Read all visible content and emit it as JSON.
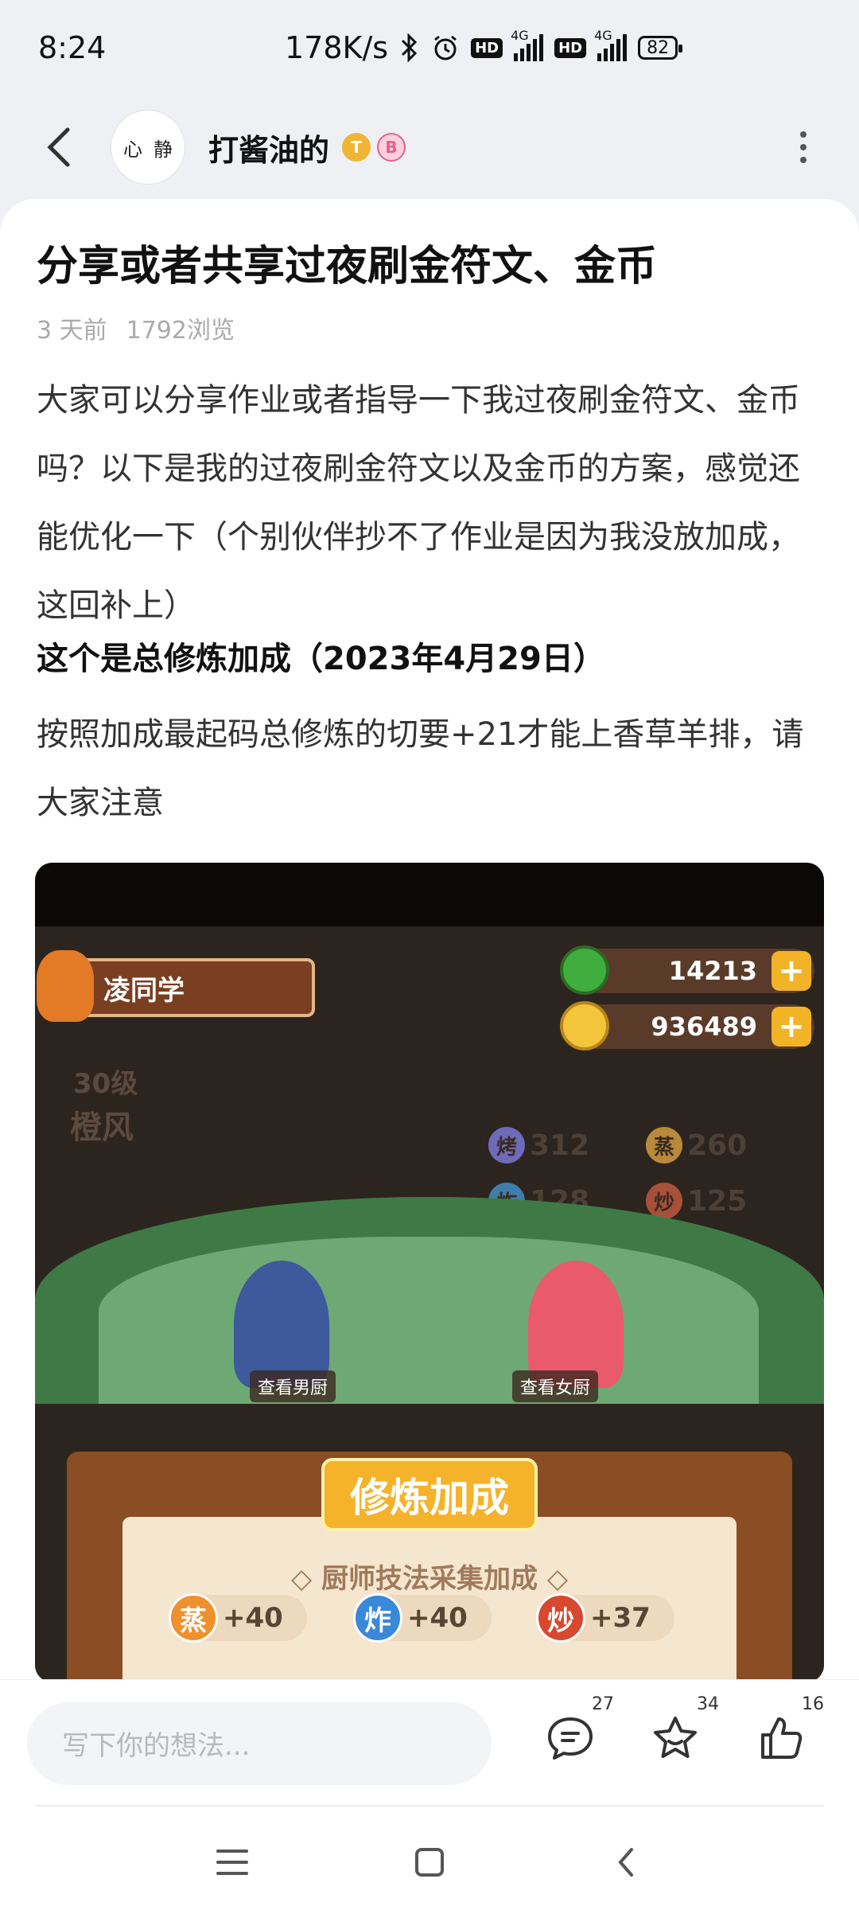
{
  "status_bar": {
    "time": "8:24",
    "net_speed": "178K/s",
    "signal_tag": "4G",
    "hd_label": "HD",
    "battery": "82"
  },
  "header": {
    "avatar_text_1": "心",
    "avatar_text_2": "静",
    "username": "打酱油的",
    "badge_t": "T",
    "badge_b": "B"
  },
  "post": {
    "title": "分享或者共享过夜刷金符文、金币",
    "time_ago": "3 天前",
    "views": "1792浏览",
    "body": "大家可以分享作业或者指导一下我过夜刷金符文、金币吗？以下是我的过夜刷金符文以及金币的方案，感觉还能优化一下（个别伙伴抄不了作业是因为我没放加成，这回补上）",
    "subtitle": "这个是总修炼加成（2023年4月29日）",
    "note": "按照加成最起码总修炼的切要+21才能上香草羊排，请大家注意"
  },
  "game_screenshot": {
    "player_name": "凌同学",
    "jade": "14213",
    "coins": "936489",
    "level": "30级",
    "char_name": "橙风",
    "skills": [
      {
        "icon": "烤",
        "value": "312"
      },
      {
        "icon": "蒸",
        "value": "260"
      },
      {
        "icon": "炸",
        "value": "128"
      },
      {
        "icon": "炒",
        "value": "125"
      }
    ],
    "view_male_chef": "查看男厨",
    "view_female_chef": "查看女厨",
    "bonus_title": "修炼加成",
    "collect_title": "◇ 厨师技法采集加成 ◇",
    "bonuses": [
      {
        "icon": "蒸",
        "value": "+40",
        "color": "#f0902c"
      },
      {
        "icon": "炸",
        "value": "+40",
        "color": "#3a88d8"
      },
      {
        "icon": "炒",
        "value": "+37",
        "color": "#d8482e"
      }
    ]
  },
  "comment_bar": {
    "placeholder": "写下你的想法...",
    "comments_count": "27",
    "favorites_count": "34",
    "likes_count": "16"
  }
}
